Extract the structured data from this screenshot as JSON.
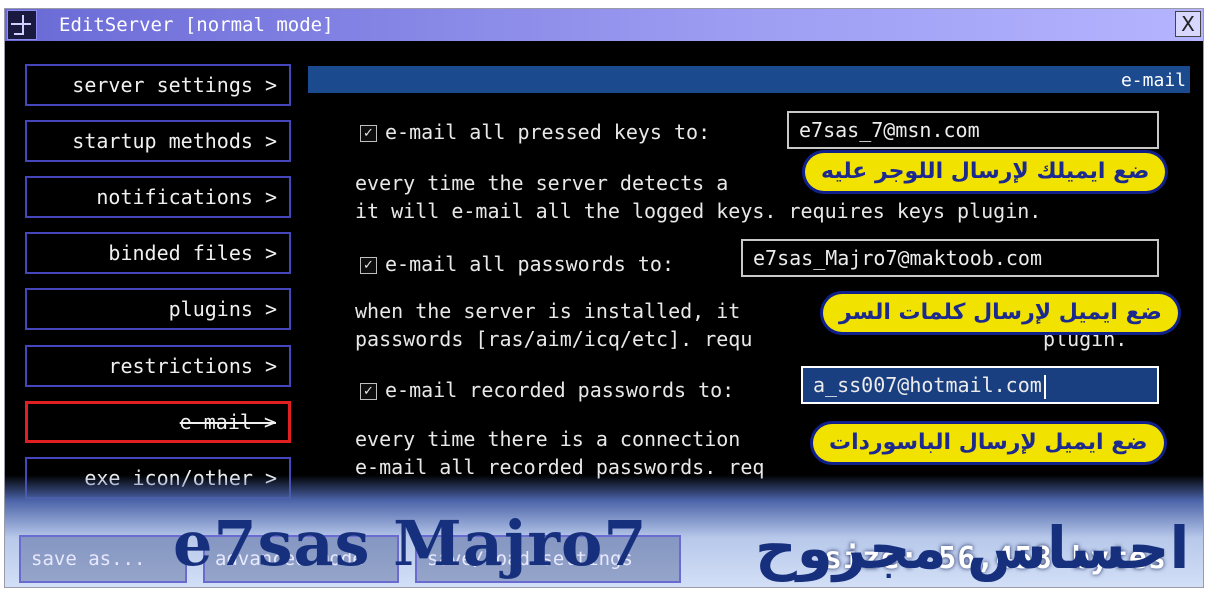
{
  "window": {
    "title": "EditServer [normal mode]",
    "close_glyph": "X"
  },
  "sidebar": {
    "items": [
      {
        "label": "server settings >"
      },
      {
        "label": "startup methods >"
      },
      {
        "label": "notifications >"
      },
      {
        "label": "binded files >"
      },
      {
        "label": "plugins >"
      },
      {
        "label": "restrictions >"
      },
      {
        "label": "e-mail >",
        "active": true
      },
      {
        "label": "exe icon/other >"
      }
    ]
  },
  "section": {
    "title": "e-mail"
  },
  "options": [
    {
      "checked": true,
      "label": "e-mail all pressed keys to:",
      "value": "e7sas_7@msn.com",
      "desc_line1": "every time the server detects a",
      "desc_line2": "it will e-mail all the logged keys. requires keys plugin.",
      "annotation": "ضع ايميلك لإرسال اللوجر عليه"
    },
    {
      "checked": true,
      "label": "e-mail all passwords to:",
      "value": "e7sas_Majro7@maktoob.com",
      "desc_line1": "when the server is installed, it",
      "desc_line2": "passwords [ras/aim/icq/etc]. requ",
      "desc_line2_tail": "plugin.",
      "annotation": "ضع ايميل لإرسال كلمات السر"
    },
    {
      "checked": true,
      "label": "e-mail recorded passwords to:",
      "value": "a_ss007@hotmail.com",
      "desc_line1": "every time there is a connection",
      "desc_line2": "e-mail all recorded passwords. req",
      "annotation": "ضع ايميل لإرسال الباسوردات"
    }
  ],
  "bottom": {
    "save_as": "save as...",
    "advanced": "advanced mode",
    "save_load": "save/load settings",
    "size_label": "size: 56,458 bytes"
  },
  "watermark": {
    "latin": "e7sas Majro7",
    "arabic": "احساس مجروح"
  },
  "colors": {
    "titlebar": "#9c9cf2",
    "section_bar": "#1c4a8e",
    "active_border": "#e02020",
    "annotation_bg": "#f2e200"
  }
}
